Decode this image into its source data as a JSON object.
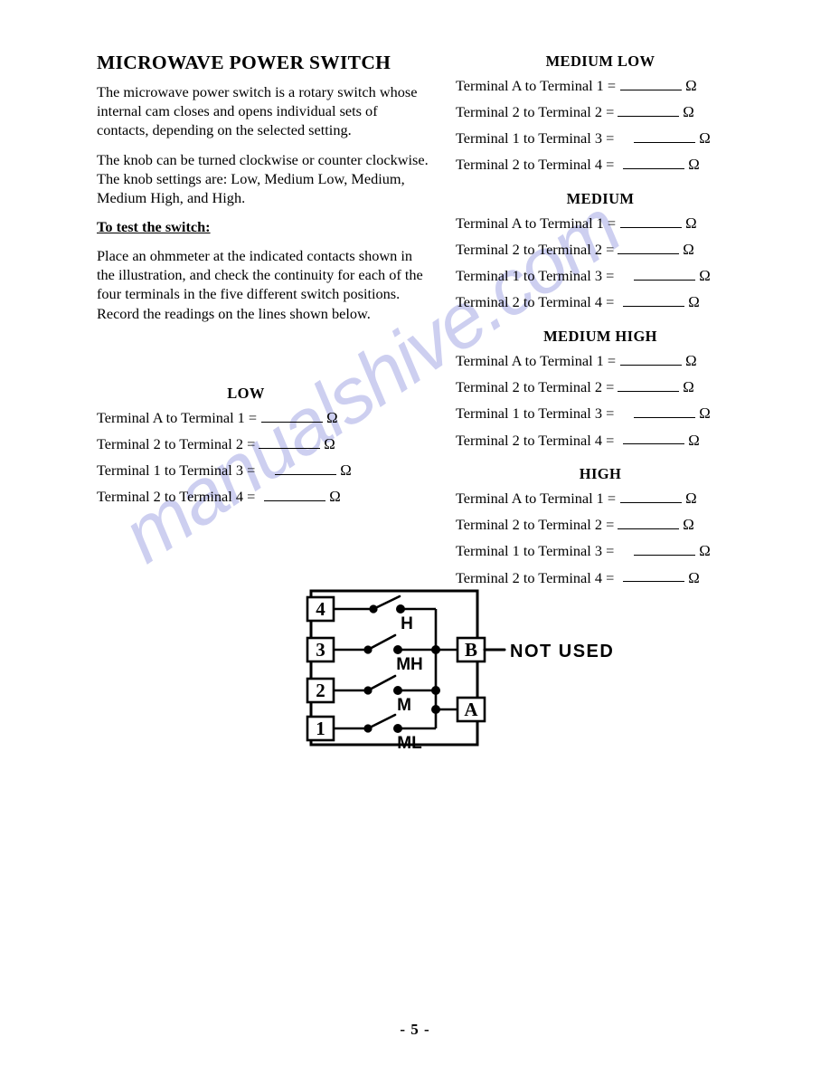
{
  "document": {
    "title": "MICROWAVE POWER SWITCH",
    "page_number": "- 5 -",
    "watermark": "manualshive.com"
  },
  "intro": {
    "paragraph1": "The microwave power switch is a rotary switch whose internal cam closes and opens individual sets of contacts, depending on the selected setting.",
    "paragraph2": "The knob can be turned clockwise or counter clockwise. The knob settings are: Low, Medium Low, Medium, Medium High, and High.",
    "subheading": "To test the switch:",
    "paragraph3": "Place an ohmmeter at the indicated contacts shown in the illustration, and check the continuity for each of the four terminals in the five different switch positions. Record the readings on the lines shown below."
  },
  "reading_rows": [
    {
      "label": "Terminal A to Terminal 1 =",
      "unit": "Ω"
    },
    {
      "label": "Terminal 2 to Terminal 2 =",
      "unit": "Ω"
    },
    {
      "label": "Terminal 1 to Terminal 3 =",
      "unit": "Ω"
    },
    {
      "label": "Terminal 2 to Terminal 4 =",
      "unit": "Ω"
    }
  ],
  "sections": {
    "low": {
      "title": "LOW"
    },
    "medium_low": {
      "title": "MEDIUM LOW"
    },
    "medium": {
      "title": "MEDIUM"
    },
    "medium_high": {
      "title": "MEDIUM HIGH"
    },
    "high": {
      "title": "HIGH"
    }
  },
  "diagram": {
    "terminals_left": [
      "4",
      "3",
      "2",
      "1"
    ],
    "contact_labels": [
      "H",
      "MH",
      "M",
      "ML"
    ],
    "terminal_b": "B",
    "terminal_a": "A",
    "annotation": "NOT USED"
  }
}
